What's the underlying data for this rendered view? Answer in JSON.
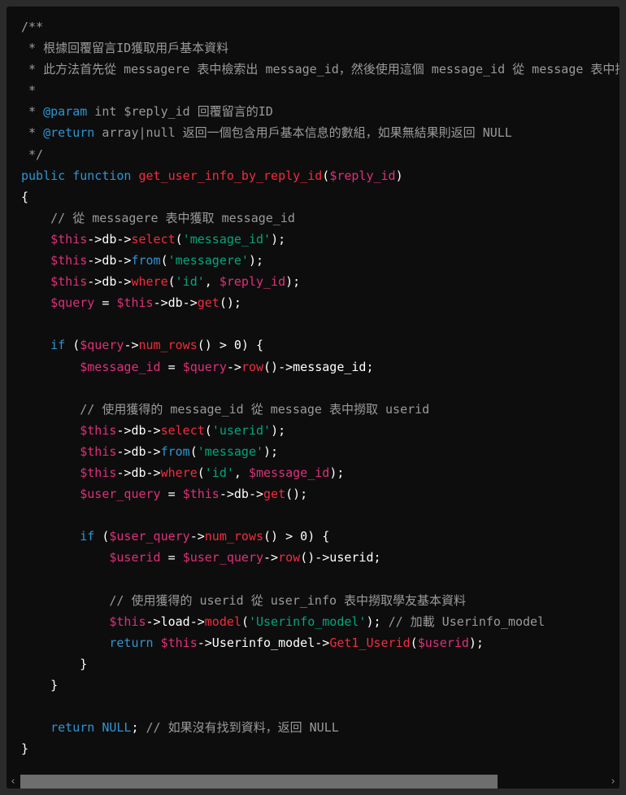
{
  "colors": {
    "background": "#0d0d0d",
    "comment": "#9a9a9a",
    "keyword": "#2e95d3",
    "function": "#f22c3d",
    "variable": "#df3079",
    "string": "#00a67d",
    "plain": "#ffffff"
  },
  "scrollbar": {
    "left_icon": "chevron-left-icon",
    "right_icon": "chevron-right-icon",
    "left_glyph": "‹",
    "right_glyph": "›",
    "horizontal_scroll_fraction_visible": 0.78
  },
  "code_lines": [
    [
      [
        "c",
        "/**"
      ]
    ],
    [
      [
        "c",
        " * 根據回覆留言ID獲取用戶基本資料"
      ]
    ],
    [
      [
        "c",
        " * 此方法首先從 messagere 表中檢索出 message_id，然後使用這個 message_id 從 message 表中撈取 userid，再從 user_info 表中撈取學友基本資料"
      ]
    ],
    [
      [
        "c",
        " *"
      ]
    ],
    [
      [
        "c",
        " * "
      ],
      [
        "k",
        "@param"
      ],
      [
        "c",
        " int $reply_id 回覆留言的ID"
      ]
    ],
    [
      [
        "c",
        " * "
      ],
      [
        "k",
        "@return"
      ],
      [
        "c",
        " array|null 返回一個包含用戶基本信息的數組，如果無結果則返回 NULL"
      ]
    ],
    [
      [
        "c",
        " */"
      ]
    ],
    [
      [
        "k",
        "public"
      ],
      [
        "p",
        " "
      ],
      [
        "k",
        "function"
      ],
      [
        "p",
        " "
      ],
      [
        "f",
        "get_user_info_by_reply_id"
      ],
      [
        "p",
        "("
      ],
      [
        "v",
        "$reply_id"
      ],
      [
        "p",
        ")"
      ]
    ],
    [
      [
        "p",
        "{"
      ]
    ],
    [
      [
        "p",
        "    "
      ],
      [
        "c",
        "// 從 messagere 表中獲取 message_id"
      ]
    ],
    [
      [
        "p",
        "    "
      ],
      [
        "v",
        "$this"
      ],
      [
        "p",
        "->db->"
      ],
      [
        "f",
        "select"
      ],
      [
        "p",
        "("
      ],
      [
        "s",
        "'message_id'"
      ],
      [
        "p",
        ");"
      ]
    ],
    [
      [
        "p",
        "    "
      ],
      [
        "v",
        "$this"
      ],
      [
        "p",
        "->db->"
      ],
      [
        "k",
        "from"
      ],
      [
        "p",
        "("
      ],
      [
        "s",
        "'messagere'"
      ],
      [
        "p",
        ");"
      ]
    ],
    [
      [
        "p",
        "    "
      ],
      [
        "v",
        "$this"
      ],
      [
        "p",
        "->db->"
      ],
      [
        "f",
        "where"
      ],
      [
        "p",
        "("
      ],
      [
        "s",
        "'id'"
      ],
      [
        "p",
        ", "
      ],
      [
        "v",
        "$reply_id"
      ],
      [
        "p",
        ");"
      ]
    ],
    [
      [
        "p",
        "    "
      ],
      [
        "v",
        "$query"
      ],
      [
        "p",
        " = "
      ],
      [
        "v",
        "$this"
      ],
      [
        "p",
        "->db->"
      ],
      [
        "f",
        "get"
      ],
      [
        "p",
        "();"
      ]
    ],
    [
      [
        "p",
        ""
      ]
    ],
    [
      [
        "p",
        "    "
      ],
      [
        "k",
        "if"
      ],
      [
        "p",
        " ("
      ],
      [
        "v",
        "$query"
      ],
      [
        "p",
        "->"
      ],
      [
        "f",
        "num_rows"
      ],
      [
        "p",
        "() > 0) {"
      ]
    ],
    [
      [
        "p",
        "        "
      ],
      [
        "v",
        "$message_id"
      ],
      [
        "p",
        " = "
      ],
      [
        "v",
        "$query"
      ],
      [
        "p",
        "->"
      ],
      [
        "f",
        "row"
      ],
      [
        "p",
        "()->message_id;"
      ]
    ],
    [
      [
        "p",
        ""
      ]
    ],
    [
      [
        "p",
        "        "
      ],
      [
        "c",
        "// 使用獲得的 message_id 從 message 表中撈取 userid"
      ]
    ],
    [
      [
        "p",
        "        "
      ],
      [
        "v",
        "$this"
      ],
      [
        "p",
        "->db->"
      ],
      [
        "f",
        "select"
      ],
      [
        "p",
        "("
      ],
      [
        "s",
        "'userid'"
      ],
      [
        "p",
        ");"
      ]
    ],
    [
      [
        "p",
        "        "
      ],
      [
        "v",
        "$this"
      ],
      [
        "p",
        "->db->"
      ],
      [
        "k",
        "from"
      ],
      [
        "p",
        "("
      ],
      [
        "s",
        "'message'"
      ],
      [
        "p",
        ");"
      ]
    ],
    [
      [
        "p",
        "        "
      ],
      [
        "v",
        "$this"
      ],
      [
        "p",
        "->db->"
      ],
      [
        "f",
        "where"
      ],
      [
        "p",
        "("
      ],
      [
        "s",
        "'id'"
      ],
      [
        "p",
        ", "
      ],
      [
        "v",
        "$message_id"
      ],
      [
        "p",
        ");"
      ]
    ],
    [
      [
        "p",
        "        "
      ],
      [
        "v",
        "$user_query"
      ],
      [
        "p",
        " = "
      ],
      [
        "v",
        "$this"
      ],
      [
        "p",
        "->db->"
      ],
      [
        "f",
        "get"
      ],
      [
        "p",
        "();"
      ]
    ],
    [
      [
        "p",
        ""
      ]
    ],
    [
      [
        "p",
        "        "
      ],
      [
        "k",
        "if"
      ],
      [
        "p",
        " ("
      ],
      [
        "v",
        "$user_query"
      ],
      [
        "p",
        "->"
      ],
      [
        "f",
        "num_rows"
      ],
      [
        "p",
        "() > 0) {"
      ]
    ],
    [
      [
        "p",
        "            "
      ],
      [
        "v",
        "$userid"
      ],
      [
        "p",
        " = "
      ],
      [
        "v",
        "$user_query"
      ],
      [
        "p",
        "->"
      ],
      [
        "f",
        "row"
      ],
      [
        "p",
        "()->userid;"
      ]
    ],
    [
      [
        "p",
        ""
      ]
    ],
    [
      [
        "p",
        "            "
      ],
      [
        "c",
        "// 使用獲得的 userid 從 user_info 表中撈取學友基本資料"
      ]
    ],
    [
      [
        "p",
        "            "
      ],
      [
        "v",
        "$this"
      ],
      [
        "p",
        "->load->"
      ],
      [
        "f",
        "model"
      ],
      [
        "p",
        "("
      ],
      [
        "s",
        "'Userinfo_model'"
      ],
      [
        "p",
        "); "
      ],
      [
        "c",
        "// 加載 Userinfo_model"
      ]
    ],
    [
      [
        "p",
        "            "
      ],
      [
        "k",
        "return"
      ],
      [
        "p",
        " "
      ],
      [
        "v",
        "$this"
      ],
      [
        "p",
        "->Userinfo_model->"
      ],
      [
        "f",
        "Get1_Userid"
      ],
      [
        "p",
        "("
      ],
      [
        "v",
        "$userid"
      ],
      [
        "p",
        ");"
      ]
    ],
    [
      [
        "p",
        "        }"
      ]
    ],
    [
      [
        "p",
        "    }"
      ]
    ],
    [
      [
        "p",
        ""
      ]
    ],
    [
      [
        "p",
        "    "
      ],
      [
        "k",
        "return"
      ],
      [
        "p",
        " "
      ],
      [
        "k",
        "NULL"
      ],
      [
        "p",
        "; "
      ],
      [
        "c",
        "// 如果沒有找到資料，返回 NULL"
      ]
    ],
    [
      [
        "p",
        "}"
      ]
    ]
  ]
}
